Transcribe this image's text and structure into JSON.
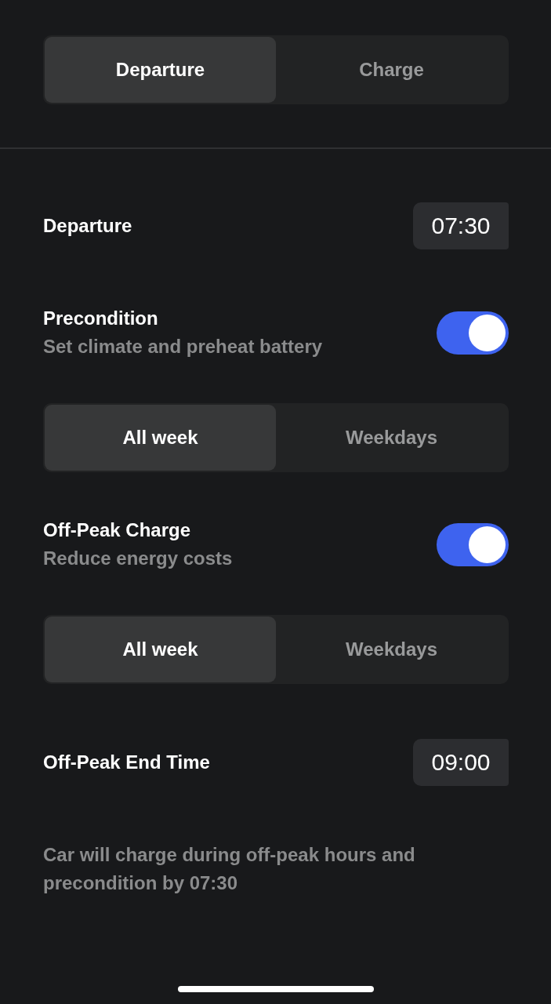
{
  "mode_tabs": [
    {
      "label": "Departure",
      "selected": true
    },
    {
      "label": "Charge",
      "selected": false
    }
  ],
  "settings": [
    {
      "kind": "time",
      "label": "Departure",
      "value": "07:30"
    },
    {
      "kind": "toggle",
      "title": "Precondition",
      "subtitle": "Set climate and preheat battery",
      "on": true
    },
    {
      "kind": "segment",
      "options": [
        {
          "label": "All week",
          "selected": true
        },
        {
          "label": "Weekdays",
          "selected": false
        }
      ]
    },
    {
      "kind": "toggle",
      "title": "Off-Peak Charge",
      "subtitle": "Reduce energy costs",
      "on": true
    },
    {
      "kind": "segment",
      "options": [
        {
          "label": "All week",
          "selected": true
        },
        {
          "label": "Weekdays",
          "selected": false
        }
      ]
    },
    {
      "kind": "time",
      "label": "Off-Peak End Time",
      "value": "09:00"
    }
  ],
  "note": "Car will charge during off-peak hours and precondition by 07:30"
}
